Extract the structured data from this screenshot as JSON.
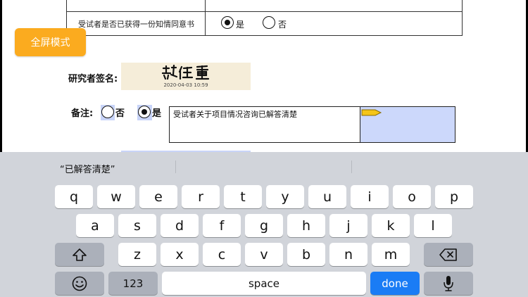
{
  "form": {
    "consent_question": "受试者是否已获得一份知情同意书",
    "consent_yes": "是",
    "consent_no": "否",
    "consent_selected": "是"
  },
  "fullscreen_button": "全屏模式",
  "signature": {
    "label": "研究者签名:",
    "signature_text": "樊任重",
    "timestamp": "2020-04-03 10:59"
  },
  "note": {
    "label": "备注:",
    "option_no": "否",
    "option_yes": "是",
    "selected": "是",
    "text": "受试者关于项目情况咨询已解答清楚"
  },
  "keyboard": {
    "prediction": "“已解答清楚”",
    "row1": [
      "q",
      "w",
      "e",
      "r",
      "t",
      "y",
      "u",
      "i",
      "o",
      "p"
    ],
    "row2": [
      "a",
      "s",
      "d",
      "f",
      "g",
      "h",
      "j",
      "k",
      "l"
    ],
    "row3": [
      "z",
      "x",
      "c",
      "v",
      "b",
      "n",
      "m"
    ],
    "numbers_key": "123",
    "space_key": "space",
    "done_key": "done",
    "shift_icon": "shift-icon",
    "delete_icon": "backspace-icon",
    "emoji_icon": "emoji-icon",
    "mic_icon": "microphone-icon"
  },
  "colors": {
    "fullscreen_button": "#fbab1f",
    "done_key": "#1a7cf5",
    "highlight": "#c8d4f8",
    "signature_bg": "#f5edd9"
  }
}
